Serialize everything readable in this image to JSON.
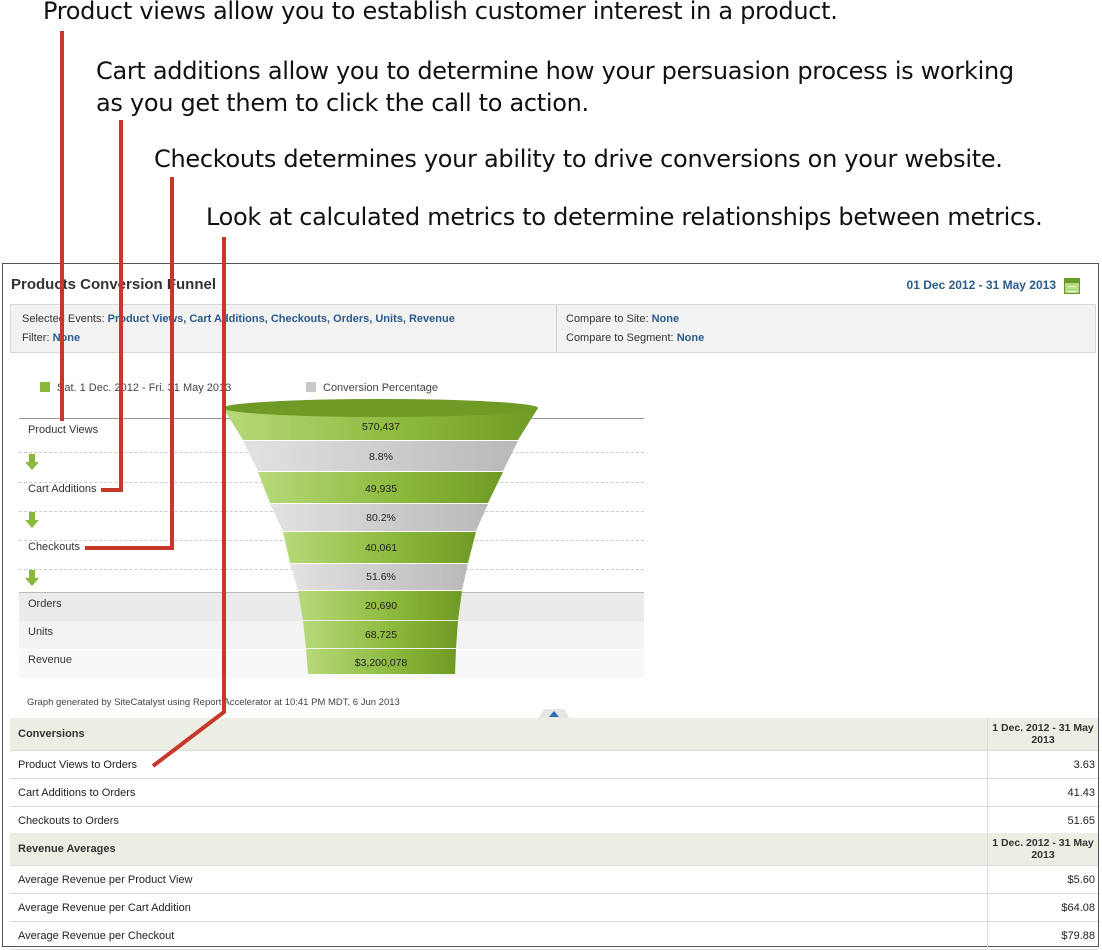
{
  "annotations": {
    "a1": "Product views allow you to establish customer interest in a product.",
    "a2_line1": "Cart additions allow you to determine how your persuasion process is working",
    "a2_line2": "as you get them to click the call to action.",
    "a3": "Checkouts determines your ability to drive conversions on your website.",
    "a4": "Look at calculated metrics to determine relationships between metrics."
  },
  "report": {
    "title": "Products Conversion Funnel",
    "date_range": "01 Dec 2012 - 31 May 2013",
    "calendar_icon": "calendar-icon",
    "selected_events_label": "Selected Events:",
    "selected_events_value": "Product Views, Cart Additions, Checkouts, Orders, Units, Revenue",
    "filter_label": "Filter:",
    "filter_value": "None",
    "compare_site_label": "Compare to Site:",
    "compare_site_value": "None",
    "compare_segment_label": "Compare to Segment:",
    "compare_segment_value": "None"
  },
  "legend": {
    "series1": "Sat.  1 Dec. 2012 - Fri. 31 May 2013",
    "series2": "Conversion Percentage",
    "color1": "#8ab83a",
    "color2": "#c9c9c9"
  },
  "funnel": {
    "rows": [
      "Product Views",
      "Cart Additions",
      "Checkouts",
      "Orders",
      "Units",
      "Revenue"
    ],
    "bands": [
      "570,437",
      "8.8%",
      "49,935",
      "80.2%",
      "40,061",
      "51.6%",
      "20,690",
      "68,725",
      "$3,200,078"
    ],
    "arrow_icon": "down-arrow-icon"
  },
  "graph_note": "Graph generated by SiteCatalyst using Report Accelerator at 10:41 PM MDT,  6 Jun 2013",
  "conversions": {
    "header": "Conversions",
    "date_header": "1 Dec. 2012 - 31 May 2013",
    "rows": [
      {
        "label": "Product Views to Orders",
        "value": "3.63"
      },
      {
        "label": "Cart Additions to Orders",
        "value": "41.43"
      },
      {
        "label": "Checkouts to Orders",
        "value": "51.65"
      }
    ]
  },
  "revenue": {
    "header": "Revenue Averages",
    "date_header": "1 Dec. 2012 - 31 May 2013",
    "rows": [
      {
        "label": "Average Revenue per Product View",
        "value": "$5.60"
      },
      {
        "label": "Average Revenue per Cart Addition",
        "value": "$64.08"
      },
      {
        "label": "Average Revenue per Checkout",
        "value": "$79.88"
      }
    ]
  },
  "colors": {
    "leader": "#c8382a",
    "green": "#8ab83a",
    "gray_band": "#c9c9c9",
    "link": "#2b5b8a"
  }
}
